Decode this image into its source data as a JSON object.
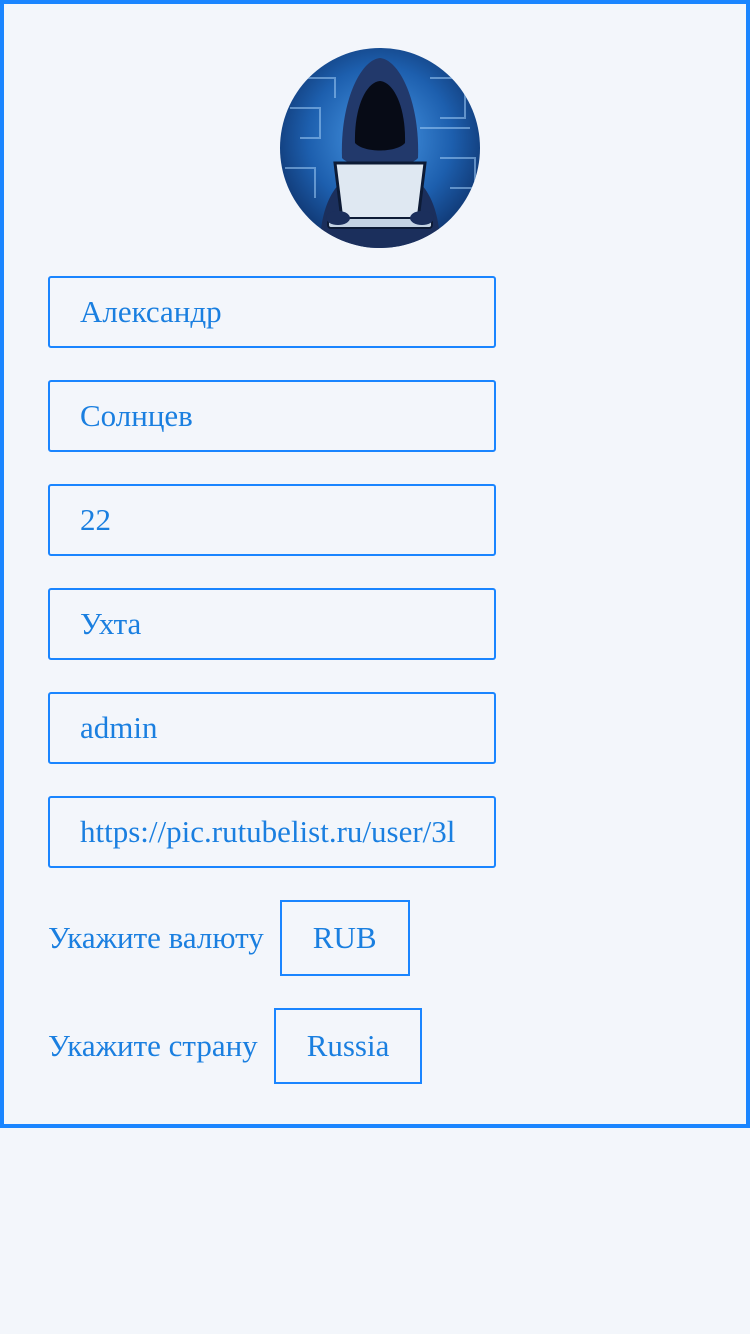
{
  "profile": {
    "avatar_alt": "hacker avatar",
    "fields": [
      {
        "value": "Александр"
      },
      {
        "value": "Солнцев"
      },
      {
        "value": "22"
      },
      {
        "value": "Ухта"
      },
      {
        "value": "admin"
      },
      {
        "value": "https://pic.rutubelist.ru/user/3l"
      }
    ],
    "currency": {
      "label": "Укажите валюту",
      "value": "RUB"
    },
    "country": {
      "label": "Укажите страну",
      "value": "Russia"
    }
  },
  "colors": {
    "accent": "#1a85ff",
    "text": "#1a7fe0",
    "background": "#f3f6fb"
  }
}
